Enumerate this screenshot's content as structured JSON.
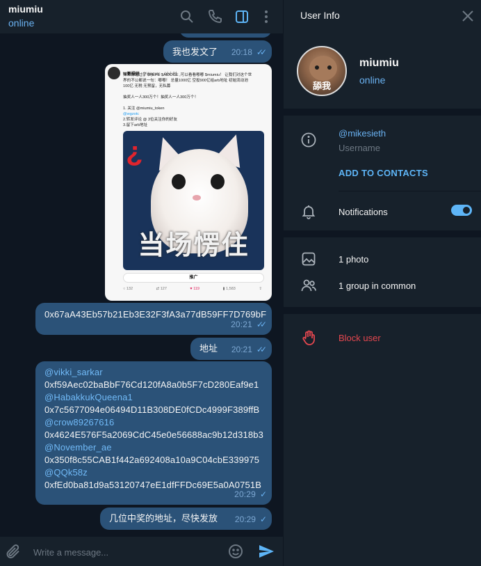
{
  "chat": {
    "title": "miumiu",
    "status": "online"
  },
  "messages": {
    "sent1": {
      "text": "我也发文了",
      "time": "20:18",
      "ticks": "✓✓"
    },
    "photo": {
      "tweet_name": "W哥报研",
      "tweet_handle": "@Wgzotc · 10小时",
      "tweet_line1": "如果你错过了 $PEPE $AIDOGE ,可以看看嘟嘟 $miumiu！ 让我们对这个世",
      "tweet_line2": "界的不公都说一句：嘟嘟！ 总量1000亿 空投900亿给arb地址 初始流动池",
      "tweet_line3": "100亿 无税 无预留，无私募",
      "tweet_line4": "抽奖人一人300万个！抽奖人一人300万个！",
      "tweet_line5": "1. 关注 @miumiu_token",
      "tweet_line6": "@wgzotc",
      "tweet_line7": "2.转发评论 @ 3位关注你的好友",
      "tweet_line8": "3.留下arb地址",
      "caption": "当场愣住",
      "promo": "推广",
      "stat_replies": "132",
      "stat_retweets": "127",
      "stat_likes": "119",
      "stat_views": "1,583"
    },
    "sent2": {
      "text": "0x67aA43Eb57b21Eb3E32F3fA3a77dB59FF7D769bF",
      "time": "20:21",
      "ticks": "✓✓"
    },
    "sent3": {
      "text": "地址",
      "time": "20:21",
      "ticks": "✓✓"
    },
    "sent4": {
      "mention1": "@vikki_sarkar",
      "addr1": "0xf59Aec02baBbF76Cd120fA8a0b5F7cD280Eaf9e1",
      "mention2": "@HabakkukQueena1",
      "addr2": "0x7c5677094e06494D11B308DE0fCDc4999F389ffB",
      "mention3": "@crow89267616",
      "addr3": "0x4624E576F5a2069CdC45e0e56688ac9b12d318b3",
      "mention4": "@November_ae",
      "addr4": "0x350f8c55CAB1f442a692408a10a9C04cbE339975",
      "mention5": "@QQk58z",
      "addr5": "0xfEd0ba81d9a53120747eE1dfFFDc69E5a0A0751B",
      "time": "20:29",
      "ticks": "✓"
    },
    "sent5": {
      "text": "几位中奖的地址，尽快发放",
      "time": "20:29",
      "ticks": "✓"
    }
  },
  "composer": {
    "placeholder": "Write a message..."
  },
  "info": {
    "title": "User Info",
    "avatar_text": "舔我",
    "name": "miumiu",
    "status": "online",
    "username": "@mikesieth",
    "username_label": "Username",
    "add_contacts": "ADD TO CONTACTS",
    "notifications": "Notifications",
    "notifications_on": true,
    "photos": "1 photo",
    "groups": "1 group in common",
    "block": "Block user"
  },
  "colors": {
    "accent": "#5eb5f7",
    "bubble_out": "#2b5278",
    "danger": "#e5474f",
    "panel": "#17212b",
    "bg": "#0e1621"
  },
  "icons": [
    "search-icon",
    "phone-icon",
    "sidebar-toggle-icon",
    "more-vertical-icon",
    "attach-icon",
    "emoji-icon",
    "send-icon",
    "close-icon",
    "info-icon",
    "bell-icon",
    "photo-icon",
    "group-icon",
    "hand-stop-icon"
  ]
}
